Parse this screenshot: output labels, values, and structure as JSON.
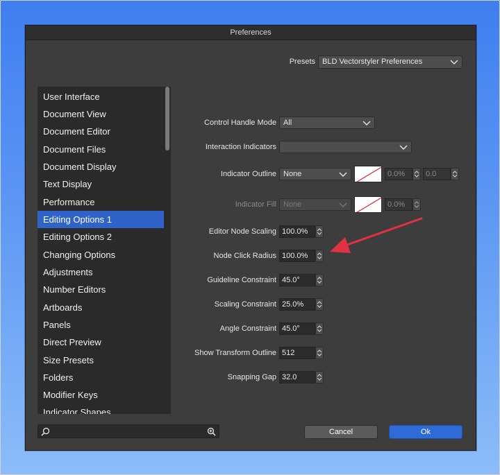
{
  "window": {
    "title": "Preferences"
  },
  "presets": {
    "label": "Presets",
    "value": "BLD Vectorstyler Preferences"
  },
  "sidebar": {
    "items": [
      {
        "label": "User Interface"
      },
      {
        "label": "Document View"
      },
      {
        "label": "Document Editor"
      },
      {
        "label": "Document Files"
      },
      {
        "label": "Document Display"
      },
      {
        "label": "Text Display"
      },
      {
        "label": "Performance"
      },
      {
        "label": "Editing Options 1"
      },
      {
        "label": "Editing Options 2"
      },
      {
        "label": "Changing Options"
      },
      {
        "label": "Adjustments"
      },
      {
        "label": "Number Editors"
      },
      {
        "label": "Artboards"
      },
      {
        "label": "Panels"
      },
      {
        "label": "Direct Preview"
      },
      {
        "label": "Size Presets"
      },
      {
        "label": "Folders"
      },
      {
        "label": "Modifier Keys"
      },
      {
        "label": "Indicator Shapes"
      }
    ],
    "selected": "Editing Options 1",
    "scroll_fraction": 0.0
  },
  "settings": {
    "control_handle_mode": {
      "label": "Control Handle Mode",
      "value": "All"
    },
    "interaction_indicators": {
      "label": "Interaction Indicators",
      "value": ""
    },
    "indicator_outline": {
      "label": "Indicator Outline",
      "value": "None",
      "opacity": "0.0%",
      "width": "0.0"
    },
    "indicator_fill": {
      "label": "Indicator Fill",
      "value": "None",
      "opacity": "0.0%",
      "disabled": true
    },
    "editor_node_scaling": {
      "label": "Editor Node Scaling",
      "value": "100.0%"
    },
    "node_click_radius": {
      "label": "Node Click Radius",
      "value": "100.0%"
    },
    "guideline_constraint": {
      "label": "Guideline Constraint",
      "value": "45.0°"
    },
    "scaling_constraint": {
      "label": "Scaling Constraint",
      "value": "25.0%"
    },
    "angle_constraint": {
      "label": "Angle Constraint",
      "value": "45.0°"
    },
    "show_transform_outline": {
      "label": "Show Transform Outline",
      "value": "512"
    },
    "snapping_gap": {
      "label": "Snapping Gap",
      "value": "32.0"
    }
  },
  "search": {
    "value": ""
  },
  "buttons": {
    "cancel": "Cancel",
    "ok": "Ok"
  },
  "colors": {
    "window_bg": "#3d3d3d",
    "sidebar_bg": "#2a2a2a",
    "selection": "#2f63c8",
    "ok_button": "#2f6bd6",
    "annotation_arrow": "#e03244",
    "swatch_slash": "#d62b2b"
  },
  "icons": {
    "search": "search-icon",
    "zoom": "zoom-plus-icon",
    "chevron": "chevron-down-icon",
    "stepper": "stepper-icon",
    "arrow": "annotation-arrow"
  }
}
